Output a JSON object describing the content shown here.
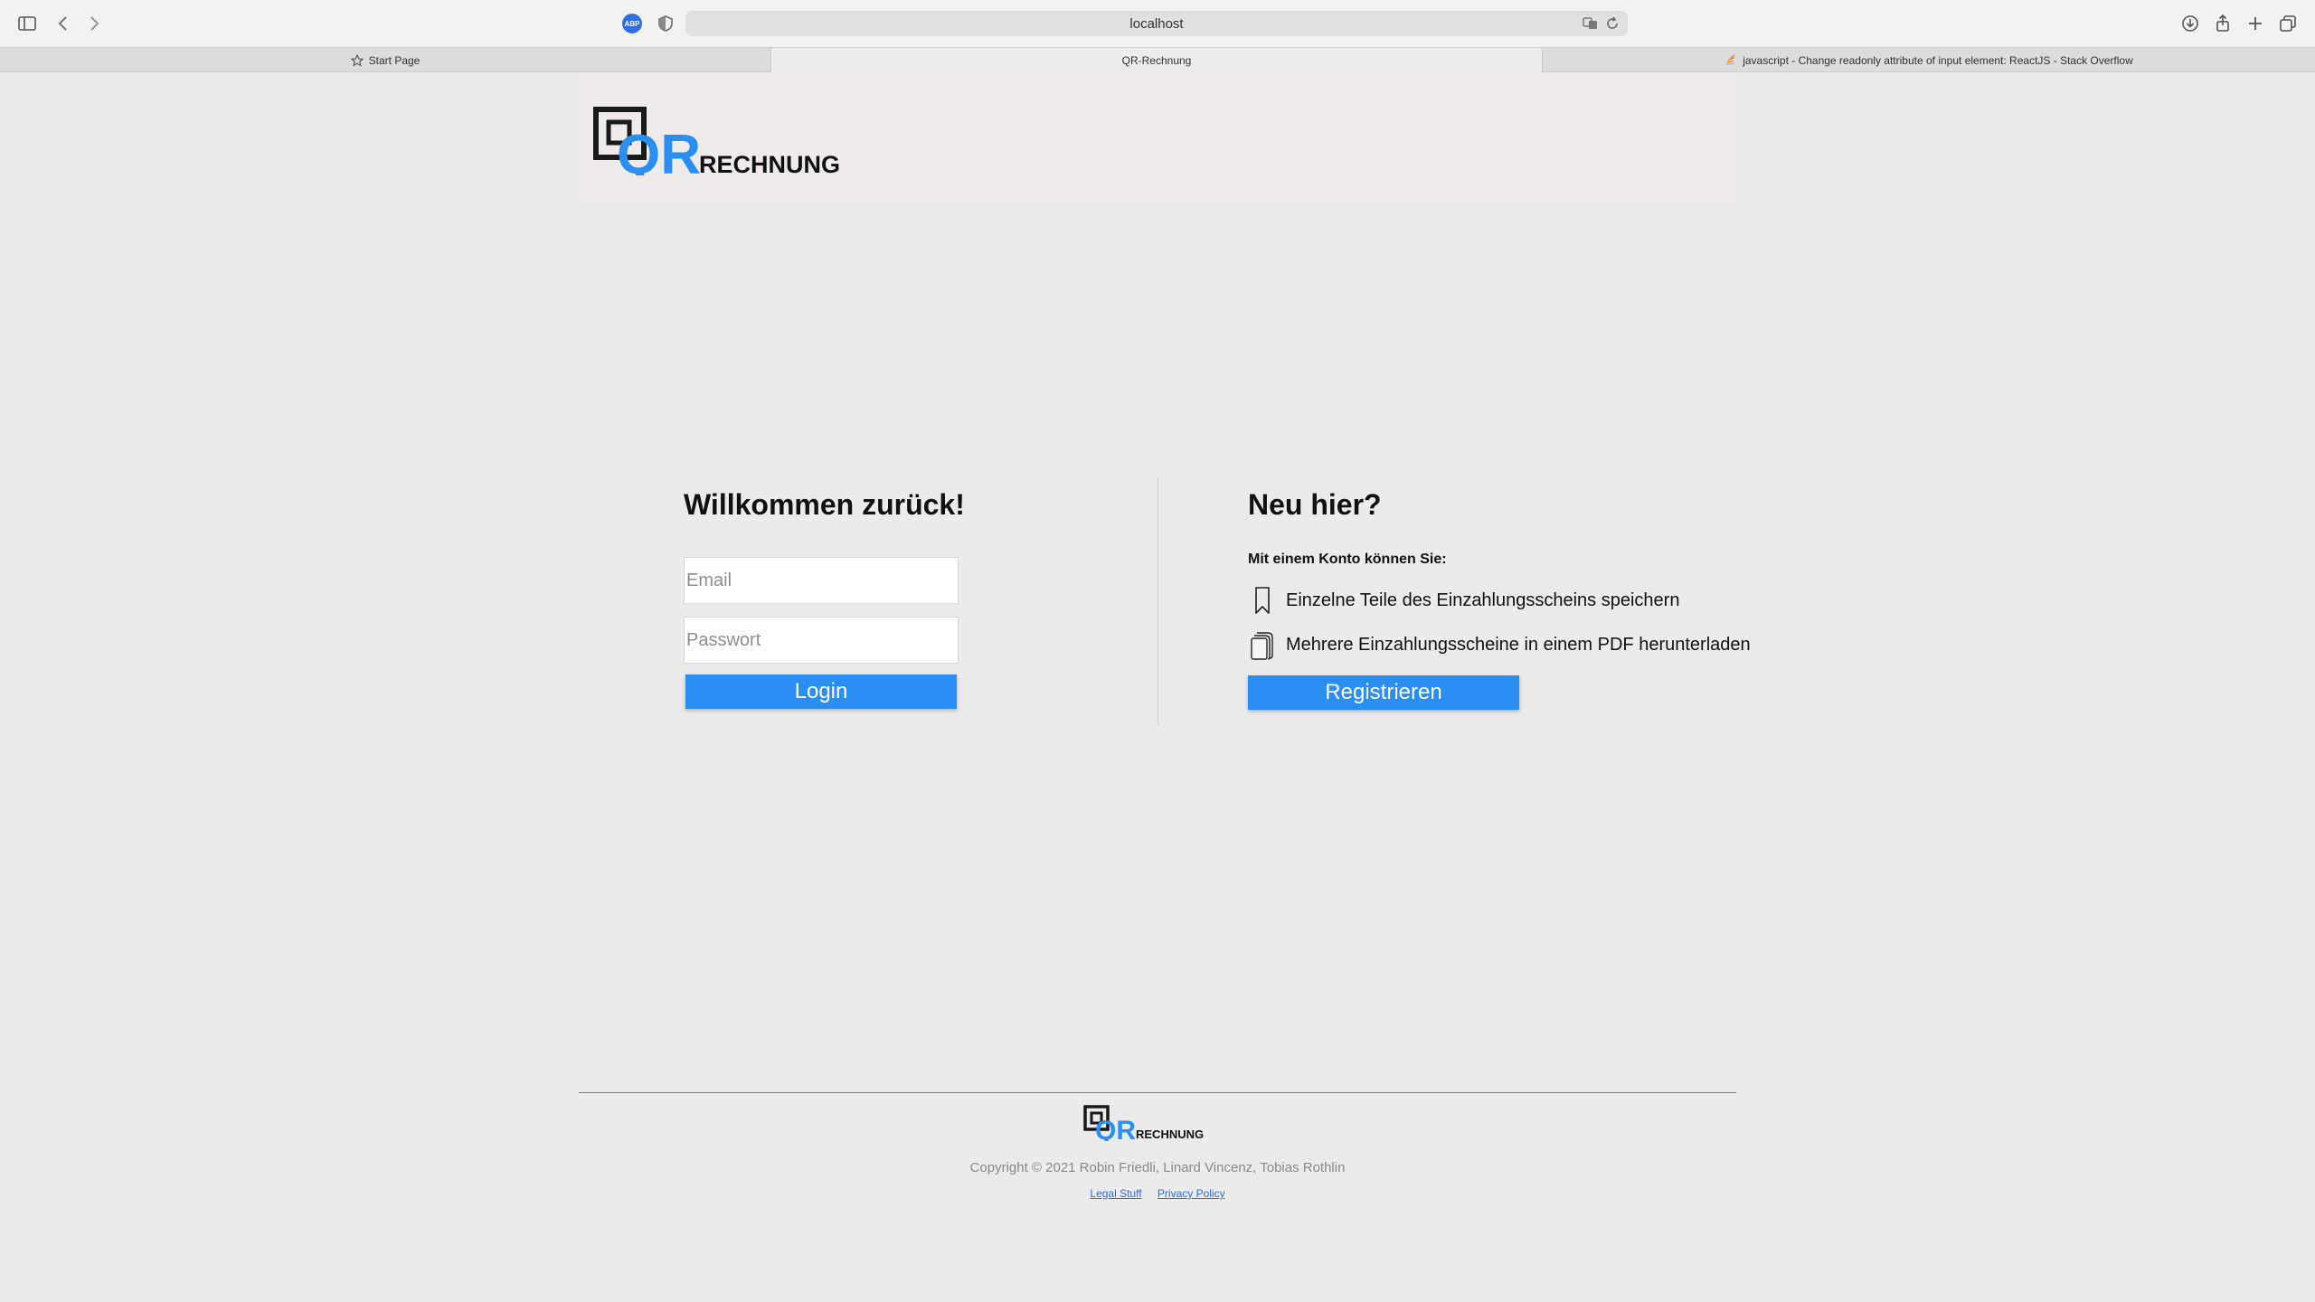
{
  "browser": {
    "url": "localhost",
    "extension_badge": "ABP",
    "tabs": [
      {
        "label": "Start Page"
      },
      {
        "label": "QR-Rechnung"
      },
      {
        "label": "javascript - Change readonly attribute of input element: ReactJS - Stack Overflow"
      }
    ]
  },
  "logo": {
    "qr": "QR",
    "word": "RECHNUNG",
    "colors": {
      "blue": "#2b8ef3",
      "dark": "#1a1a1a"
    }
  },
  "login": {
    "title": "Willkommen zurück!",
    "email_placeholder": "Email",
    "password_placeholder": "Passwort",
    "button": "Login"
  },
  "register": {
    "title": "Neu hier?",
    "subtitle": "Mit einem Konto können Sie:",
    "features": [
      {
        "icon": "bookmark-icon",
        "text": "Einzelne Teile des Einzahlungsscheins speichern"
      },
      {
        "icon": "documents-icon",
        "text": "Mehrere Einzahlungsscheine in einem PDF herunterladen"
      }
    ],
    "button": "Registrieren"
  },
  "footer": {
    "copyright": "Copyright © 2021 Robin Friedli, Linard Vincenz, Tobias Rothlin",
    "links": [
      "Legal Stuff",
      "Privacy Policy"
    ]
  },
  "colors": {
    "accent": "#2b8ef3",
    "page_bg": "#ebebeb",
    "header_bg": "#efebeb",
    "link": "#2b6ee8"
  }
}
